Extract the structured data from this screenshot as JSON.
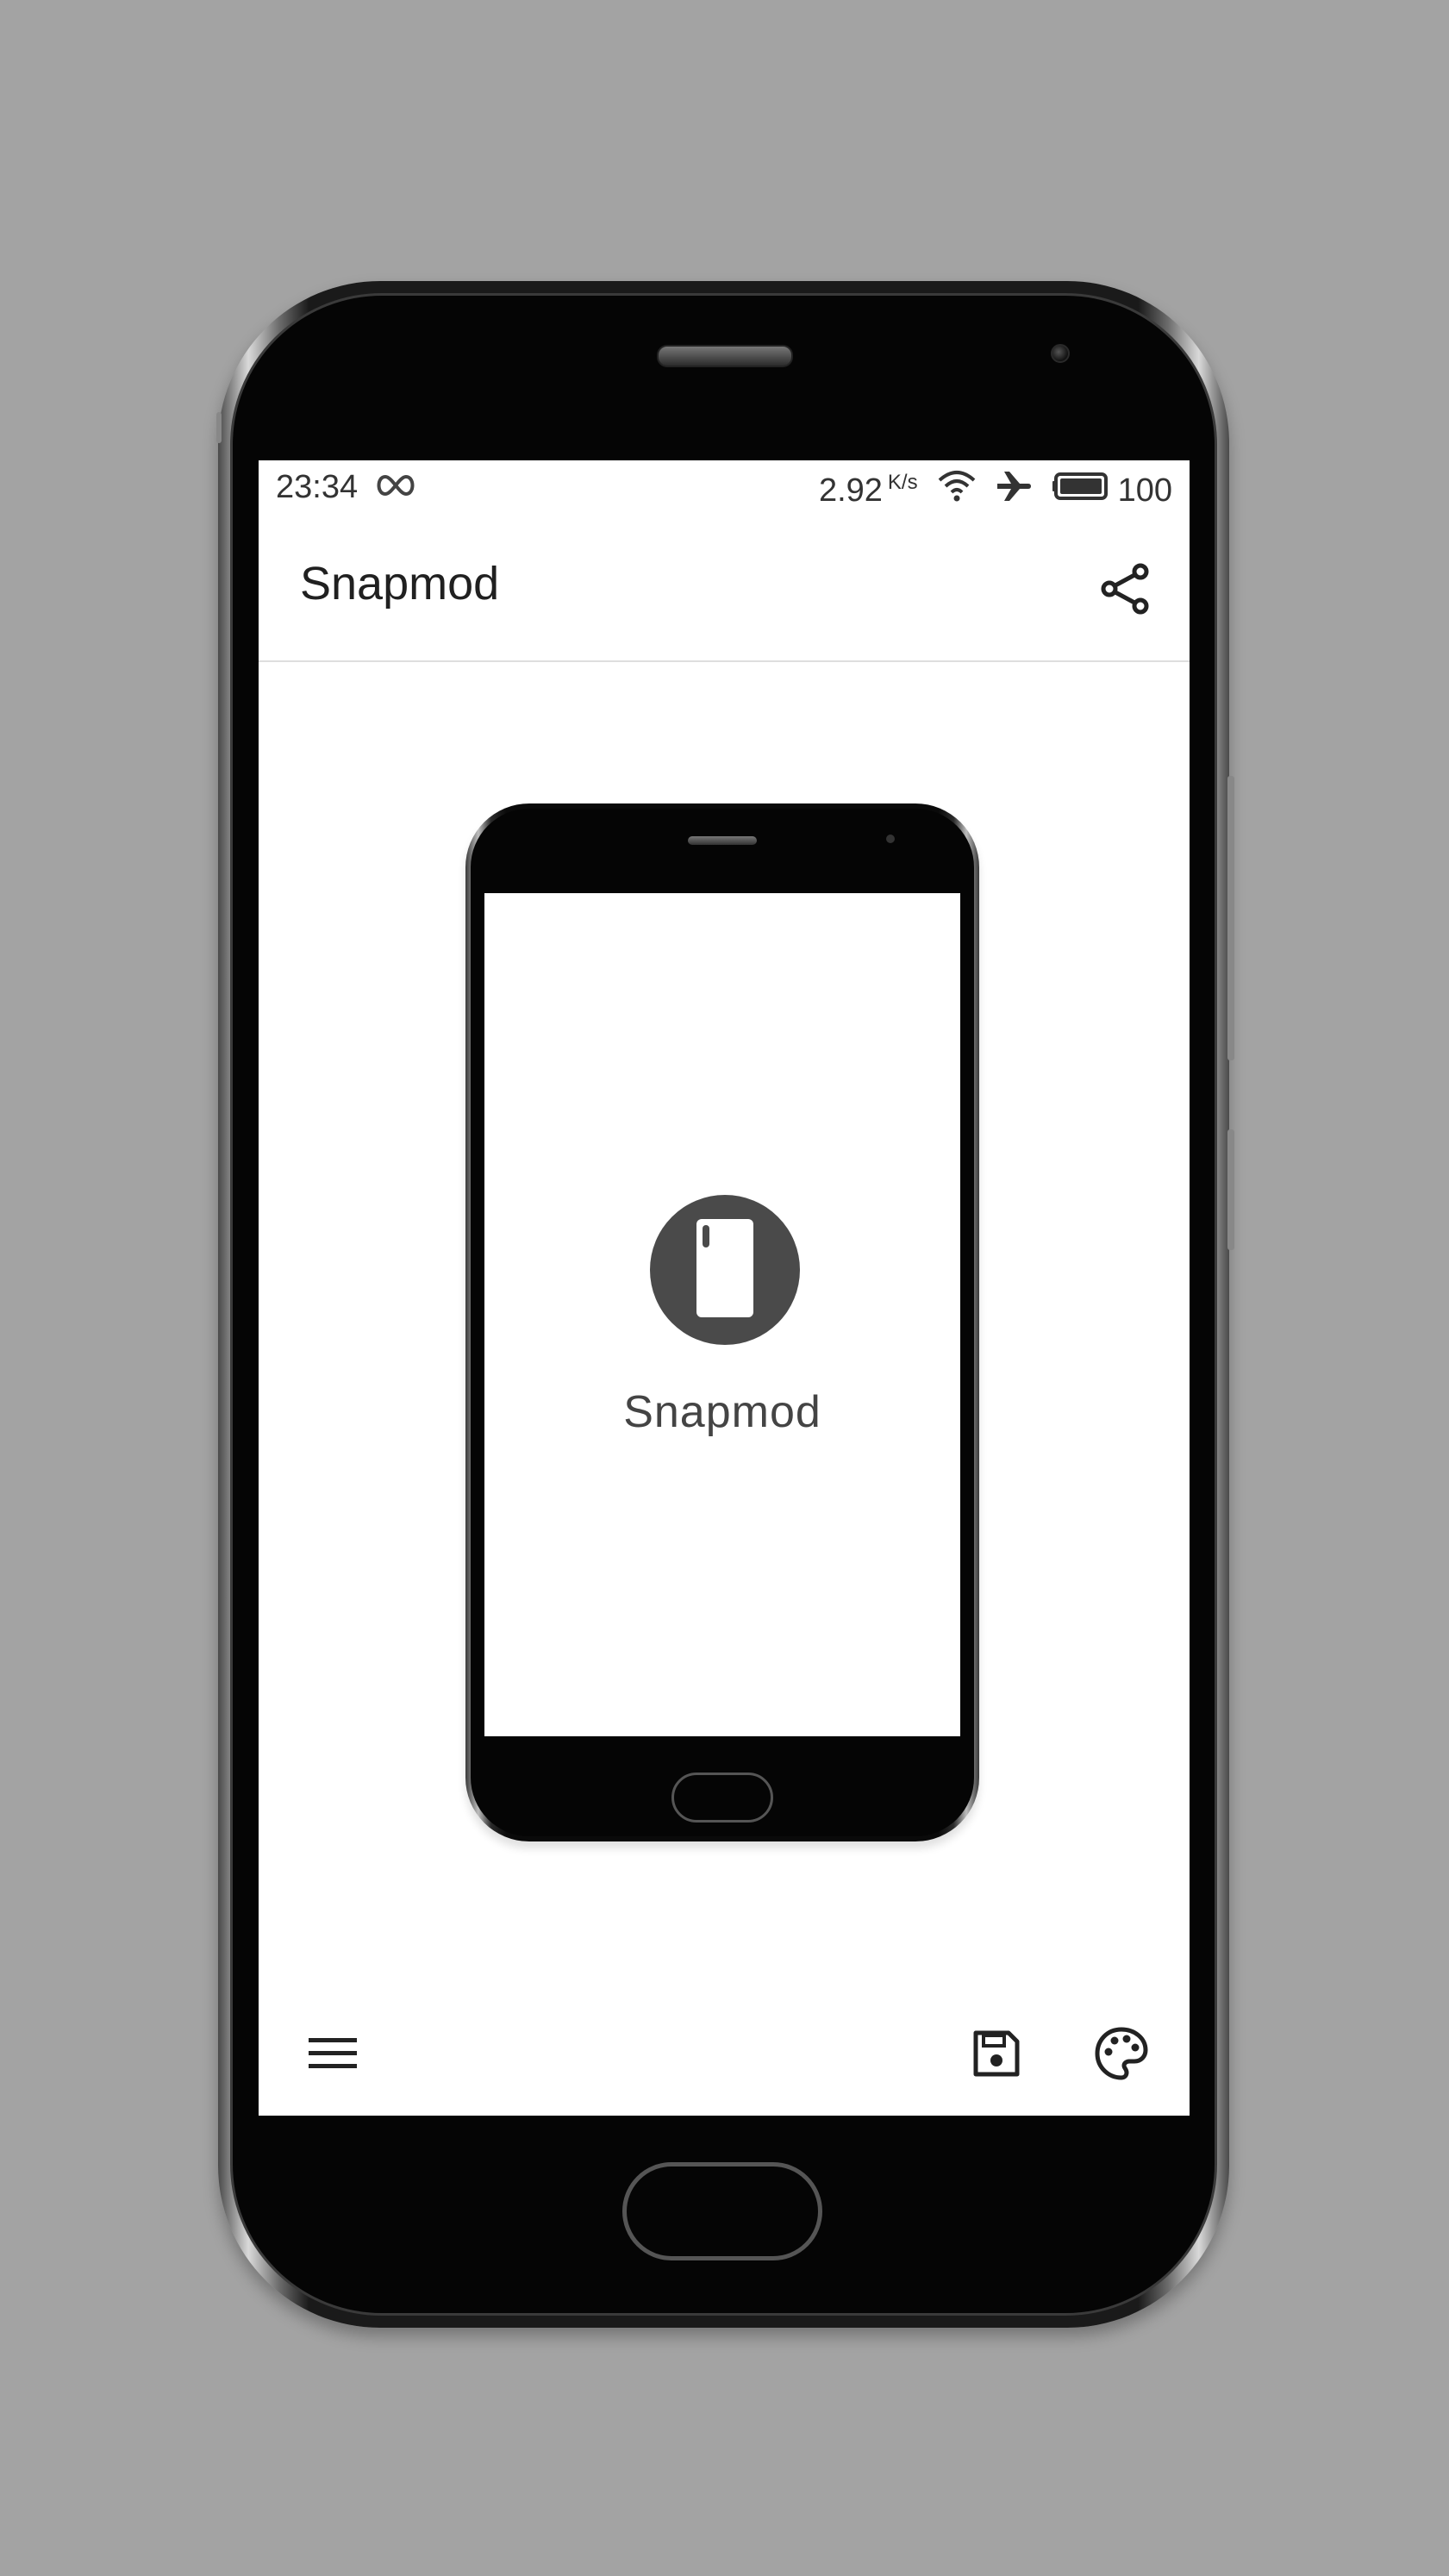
{
  "status_bar": {
    "time": "23:34",
    "infinity_icon": "infinity-icon",
    "network_speed": "2.92",
    "network_speed_unit": "K/s",
    "battery_level": "100",
    "icons": [
      "wifi-icon",
      "airplane-icon",
      "battery-icon"
    ]
  },
  "app_bar": {
    "title": "Snapmod",
    "share_icon": "share-icon"
  },
  "preview": {
    "logo_icon": "phone-icon",
    "logo_text": "Snapmod"
  },
  "bottom_bar": {
    "icons": [
      "menu-icon",
      "save-icon",
      "palette-icon"
    ]
  },
  "colors": {
    "background": "#a3a3a3",
    "screen": "#ffffff",
    "logo_circle": "#4a4a4a",
    "text_dark": "#202020"
  }
}
